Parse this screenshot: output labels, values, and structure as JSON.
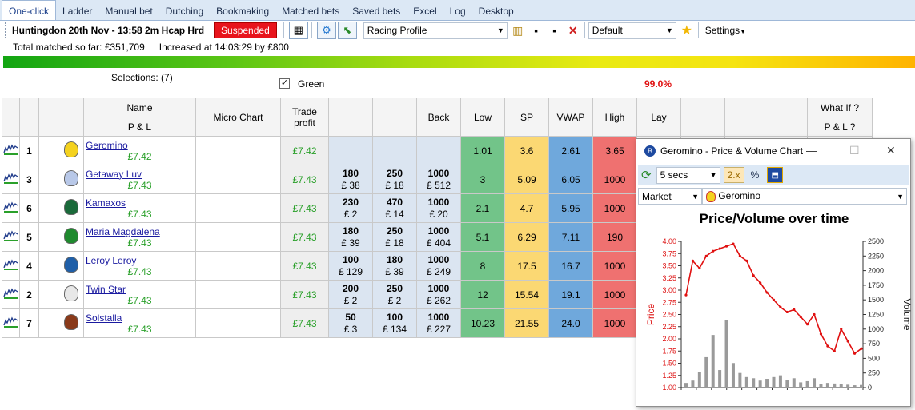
{
  "tabs": [
    "One-click",
    "Ladder",
    "Manual bet",
    "Dutching",
    "Bookmaking",
    "Matched bets",
    "Saved bets",
    "Excel",
    "Log",
    "Desktop"
  ],
  "market": {
    "title": "Huntingdon 20th Nov - 13:58 2m Hcap Hrd",
    "status": "Suspended",
    "profile": "Racing Profile",
    "staking": "Default",
    "settings_label": "Settings",
    "total_matched": "Total matched so far: £351,709",
    "increased": "Increased at 14:03:29 by £800",
    "selections_label": "Selections: (7)",
    "green_label": "Green",
    "overround": "99.0%"
  },
  "columns": {
    "name": "Name",
    "pl": "P & L",
    "micro_chart": "Micro Chart",
    "trade_profit": "Trade profit",
    "back": "Back",
    "low": "Low",
    "sp": "SP",
    "vwap": "VWAP",
    "high": "High",
    "lay": "Lay",
    "what_if": "What If ?",
    "pl_q": "P & L ?"
  },
  "runners": [
    {
      "num": "1",
      "name": "Geromino",
      "pl": "£7.42",
      "trade": "£7.42",
      "b3_odds": "",
      "b3_amt": "",
      "b2_odds": "",
      "b2_amt": "",
      "b1_odds": "",
      "b1_amt": "",
      "low": "1.01",
      "sp": "3.6",
      "vwap": "2.61",
      "high": "3.65",
      "silk": "#f4d21f"
    },
    {
      "num": "3",
      "name": "Getaway Luv",
      "pl": "£7.43",
      "trade": "£7.43",
      "b3_odds": "180",
      "b3_amt": "£ 38",
      "b2_odds": "250",
      "b2_amt": "£ 18",
      "b1_odds": "1000",
      "b1_amt": "£ 512",
      "low": "3",
      "sp": "5.09",
      "vwap": "6.05",
      "high": "1000",
      "silk": "#b8c8e8"
    },
    {
      "num": "6",
      "name": "Kamaxos",
      "pl": "£7.43",
      "trade": "£7.43",
      "b3_odds": "230",
      "b3_amt": "£ 2",
      "b2_odds": "470",
      "b2_amt": "£ 14",
      "b1_odds": "1000",
      "b1_amt": "£ 20",
      "low": "2.1",
      "sp": "4.7",
      "vwap": "5.95",
      "high": "1000",
      "silk": "#1a6a3a"
    },
    {
      "num": "5",
      "name": "Maria Magdalena",
      "pl": "£7.43",
      "trade": "£7.43",
      "b3_odds": "180",
      "b3_amt": "£ 39",
      "b2_odds": "250",
      "b2_amt": "£ 18",
      "b1_odds": "1000",
      "b1_amt": "£ 404",
      "low": "5.1",
      "sp": "6.29",
      "vwap": "7.11",
      "high": "190",
      "silk": "#1f8a2e"
    },
    {
      "num": "4",
      "name": "Leroy Leroy",
      "pl": "£7.43",
      "trade": "£7.43",
      "b3_odds": "100",
      "b3_amt": "£ 129",
      "b2_odds": "180",
      "b2_amt": "£ 39",
      "b1_odds": "1000",
      "b1_amt": "£ 249",
      "low": "8",
      "sp": "17.5",
      "vwap": "16.7",
      "high": "1000",
      "silk": "#1f5fa8"
    },
    {
      "num": "2",
      "name": "Twin Star",
      "pl": "£7.43",
      "trade": "£7.43",
      "b3_odds": "200",
      "b3_amt": "£ 2",
      "b2_odds": "250",
      "b2_amt": "£ 2",
      "b1_odds": "1000",
      "b1_amt": "£ 262",
      "low": "12",
      "sp": "15.54",
      "vwap": "19.1",
      "high": "1000",
      "silk": "#e8e8e8"
    },
    {
      "num": "7",
      "name": "Solstalla",
      "pl": "£7.43",
      "trade": "£7.43",
      "b3_odds": "50",
      "b3_amt": "£ 3",
      "b2_odds": "100",
      "b2_amt": "£ 134",
      "b1_odds": "1000",
      "b1_amt": "£ 227",
      "low": "10.23",
      "sp": "21.55",
      "vwap": "24.0",
      "high": "1000",
      "silk": "#8a3a1a"
    }
  ],
  "popup": {
    "title": "Geromino - Price & Volume Chart",
    "interval": "5 secs",
    "zoom": "2.x",
    "percent": "%",
    "market_label": "Market",
    "runner": "Geromino"
  },
  "chart_data": {
    "type": "line",
    "title": "Price/Volume over time",
    "ylabel": "Price",
    "y2label": "Volume",
    "ylim": [
      1.0,
      4.0
    ],
    "y2lim": [
      0,
      2500
    ],
    "yticks": [
      "4.00",
      "3.75",
      "3.50",
      "3.25",
      "3.00",
      "2.75",
      "2.50",
      "2.25",
      "2.00",
      "1.75",
      "1.50",
      "1.25",
      "1.00"
    ],
    "y2ticks": [
      "2500",
      "2250",
      "2000",
      "1750",
      "1500",
      "1250",
      "1000",
      "750",
      "500",
      "250",
      "0"
    ],
    "series": [
      {
        "name": "Price",
        "values": [
          2.9,
          3.6,
          3.45,
          3.7,
          3.8,
          3.85,
          3.9,
          3.95,
          3.7,
          3.6,
          3.3,
          3.15,
          2.95,
          2.8,
          2.65,
          2.55,
          2.6,
          2.45,
          2.3,
          2.5,
          2.1,
          1.85,
          1.75,
          2.2,
          1.95,
          1.7,
          1.8
        ]
      },
      {
        "name": "Volume",
        "values": [
          80,
          120,
          260,
          520,
          900,
          300,
          1150,
          420,
          250,
          180,
          160,
          120,
          150,
          180,
          210,
          130,
          160,
          90,
          110,
          160,
          60,
          80,
          70,
          60,
          50,
          40,
          45
        ]
      }
    ]
  }
}
